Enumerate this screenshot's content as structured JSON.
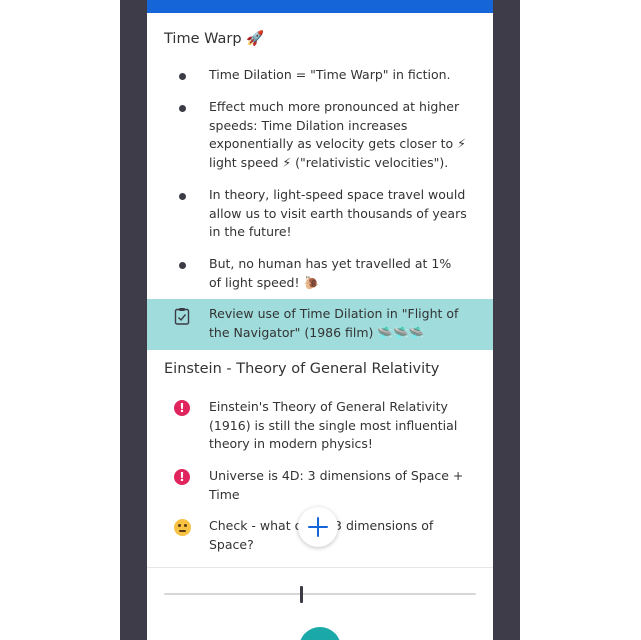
{
  "colors": {
    "frame": "#3e3c49",
    "top_bar": "#1565d8",
    "highlight": "#a0dcdc",
    "alert": "#e0245e",
    "accent_button": "#1aa8a8",
    "plus": "#1565d8"
  },
  "section1": {
    "title": "Time Warp 🚀",
    "items": [
      {
        "icon": "bullet-dot",
        "text": "Time Dilation = \"Time Warp\" in fiction."
      },
      {
        "icon": "bullet-dot",
        "text": "Effect much more pronounced at higher speeds: Time Dilation increases exponentially as velocity gets closer to ⚡ light speed ⚡ (\"relativistic velocities\")."
      },
      {
        "icon": "bullet-dot",
        "text": "In theory, light-speed space travel would allow us to visit earth thousands of years in the future!"
      },
      {
        "icon": "bullet-dot",
        "text": "But, no human has yet travelled at 1% of light speed! 🐌"
      },
      {
        "icon": "checklist-icon",
        "text": "Review use of Time Dilation in \"Flight of the Navigator\" (1986 film) 🛸🛸🛸"
      }
    ]
  },
  "section2": {
    "title": "Einstein - Theory of General Relativity",
    "items": [
      {
        "icon": "exclamation-icon",
        "text": "Einstein's Theory of General Relativity (1916) is still the single most influential theory in modern physics!"
      },
      {
        "icon": "exclamation-icon",
        "text": "Universe is 4D: 3 dimensions of Space + Time"
      },
      {
        "icon": "thinking-face-icon",
        "text": "Check - what o        3 dimensions of Space?"
      }
    ]
  },
  "slider": {
    "position": 0.44
  },
  "add_button": {
    "label": "+"
  }
}
